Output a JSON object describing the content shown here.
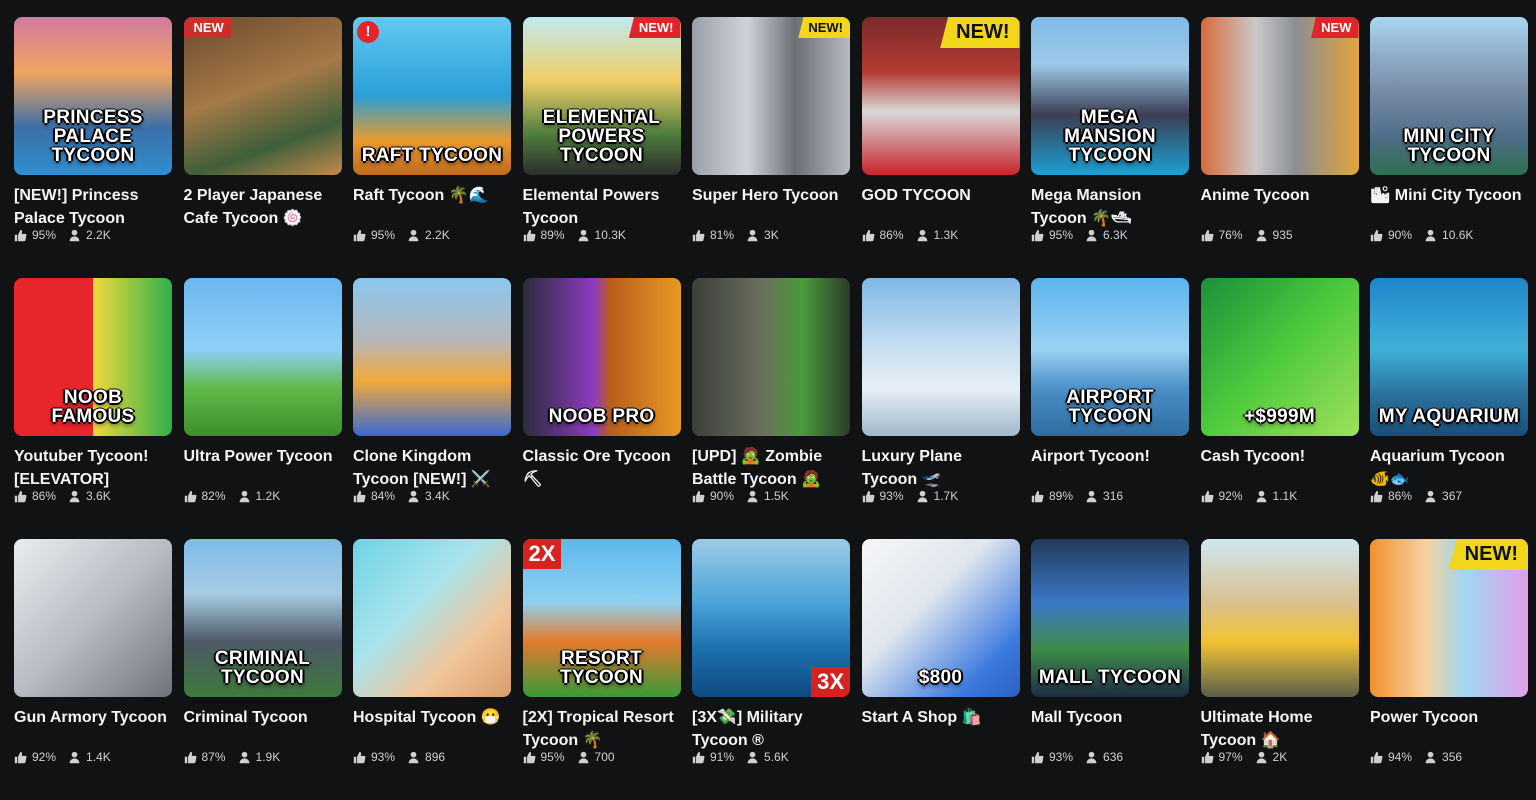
{
  "games": [
    {
      "title": "[NEW!] Princess Palace Tycoon",
      "rating": "95%",
      "players": "2.2K",
      "art_text": "PRINCESS PALACE TYCOON",
      "badge": "",
      "bg": "linear-gradient(180deg,#d07aa0 0%,#f0a460 35%,#3c6fa8 70%,#2d8fd2 100%)"
    },
    {
      "title": "2 Player Japanese Cafe Tycoon 🍥",
      "rating": "",
      "players": "",
      "art_text": "",
      "badge": "NEW",
      "bg": "linear-gradient(160deg,#6b4a2c 0%,#a67a48 45%,#3f5f3a 75%,#c48a4c 100%)"
    },
    {
      "title": "Raft Tycoon 🌴🌊",
      "rating": "95%",
      "players": "2.2K",
      "art_text": "RAFT TYCOON",
      "badge": "!",
      "bg": "linear-gradient(180deg,#63c9f2 0%,#2a9fd8 50%,#e69a2d 78%,#c06b1c 100%)"
    },
    {
      "title": "Elemental Powers Tycoon",
      "rating": "89%",
      "players": "10.3K",
      "art_text": "ELEMENTAL POWERS TYCOON",
      "badge": "NEW!",
      "bg": "linear-gradient(180deg,#bfe9f0 0%,#f0cf66 40%,#4c7b3c 75%,#2d2d2d 100%)"
    },
    {
      "title": "Super Hero Tycoon",
      "rating": "81%",
      "players": "3K",
      "art_text": "",
      "badge": "NEW!",
      "bg": "linear-gradient(90deg,#9aa0a8 0%,#cfd3d8 35%,#6b6f76 65%,#b7bbc0 100%)"
    },
    {
      "title": "GOD TYCOON",
      "rating": "86%",
      "players": "1.3K",
      "art_text": "",
      "badge": "NEW!",
      "bg": "linear-gradient(180deg,#7a2a2a 0%,#b53b33 35%,#d8d8d8 60%,#c8242a 100%)"
    },
    {
      "title": "Mega Mansion Tycoon 🌴🛥",
      "rating": "95%",
      "players": "6.3K",
      "art_text": "MEGA MANSION TYCOON",
      "badge": "",
      "bg": "linear-gradient(180deg,#7fbbe8 0%,#9dc8e8 30%,#3c3f54 62%,#1aa1d6 100%)"
    },
    {
      "title": "Anime Tycoon",
      "rating": "76%",
      "players": "935",
      "art_text": "",
      "badge": "NEW",
      "bg": "linear-gradient(90deg,#d76a3a 0%,#c9c9c9 35%,#8a8d92 60%,#e2a43a 100%)"
    },
    {
      "title": "🏙 Mini City Tycoon",
      "rating": "90%",
      "players": "10.6K",
      "art_text": "MINI CITY TYCOON",
      "badge": "",
      "bg": "linear-gradient(180deg,#a9d4f0 0%,#7b8ea8 45%,#4f6e8a 75%,#2f6f4f 100%)"
    },
    {
      "title": "Youtuber Tycoon! [ELEVATOR]",
      "rating": "86%",
      "players": "3.6K",
      "art_text": "NOOB  FAMOUS",
      "badge": "",
      "bg": "linear-gradient(90deg,#e7262b 0%,#e7262b 50%,#f0d93c 50%,#2fb04a 100%)"
    },
    {
      "title": "Ultra Power Tycoon",
      "rating": "82%",
      "players": "1.2K",
      "art_text": "",
      "badge": "",
      "bg": "linear-gradient(180deg,#6ab6f0 0%,#8fd0f7 45%,#5fb846 70%,#3c8f2c 100%)"
    },
    {
      "title": "Clone Kingdom Tycoon [NEW!] ⚔️",
      "rating": "84%",
      "players": "3.4K",
      "art_text": "",
      "badge": "",
      "bg": "linear-gradient(180deg,#8ac7ef 0%,#b6b6b6 40%,#f1a93a 65%,#3b6ad1 100%)"
    },
    {
      "title": "Classic Ore Tycoon ⛏",
      "rating": "",
      "players": "",
      "art_text": "NOOB    PRO",
      "badge": "",
      "bg": "linear-gradient(90deg,#2b2b3c 0%,#8e3cc1 45%,#b85d1c 55%,#e79a24 100%)"
    },
    {
      "title": "[UPD] 🧟 Zombie Battle Tycoon 🧟",
      "rating": "90%",
      "players": "1.5K",
      "art_text": "",
      "badge": "",
      "bg": "linear-gradient(90deg,#3b3f3a 0%,#6b705f 45%,#4a9b3a 70%,#2c3a2a 100%)"
    },
    {
      "title": "Luxury Plane Tycoon 🛫",
      "rating": "93%",
      "players": "1.7K",
      "art_text": "",
      "badge": "",
      "bg": "linear-gradient(180deg,#7fb7e6 0%,#c9dff0 45%,#e6eef5 70%,#9fb8cc 100%)"
    },
    {
      "title": "Airport Tycoon!",
      "rating": "89%",
      "players": "316",
      "art_text": "AIRPORT TYCOON",
      "badge": "",
      "bg": "linear-gradient(180deg,#5bb4ee 0%,#9bd2f3 45%,#4a8fc8 70%,#2f6da0 100%)"
    },
    {
      "title": "Cash Tycoon!",
      "rating": "92%",
      "players": "1.1K",
      "art_text": "+$999M",
      "badge": "",
      "bg": "linear-gradient(135deg,#1e8f3a 0%,#4fca3e 50%,#9fe05a 100%)"
    },
    {
      "title": "Aquarium Tycoon 🐠🐟",
      "rating": "86%",
      "players": "367",
      "art_text": "MY AQUARIUM",
      "badge": "",
      "bg": "linear-gradient(180deg,#1f86c9 0%,#3fb0d8 45%,#2a6f9a 75%,#1a4f7a 100%)"
    },
    {
      "title": "Gun Armory Tycoon",
      "rating": "92%",
      "players": "1.4K",
      "art_text": "",
      "badge": "",
      "bg": "linear-gradient(135deg,#e9ecef 0%,#b8bcc2 50%,#6f747a 100%)"
    },
    {
      "title": "Criminal Tycoon",
      "rating": "87%",
      "players": "1.9K",
      "art_text": "CRIMINAL TYCOON",
      "badge": "",
      "bg": "linear-gradient(180deg,#7fbbe8 0%,#a7cbe2 35%,#4e5966 65%,#3e7a3c 100%)"
    },
    {
      "title": "Hospital Tycoon 😷",
      "rating": "93%",
      "players": "896",
      "art_text": "",
      "badge": "",
      "bg": "linear-gradient(135deg,#6ed3e3 0%,#a8e3ec 40%,#f0c59a 70%,#d99c6a 100%)"
    },
    {
      "title": "[2X] Tropical Resort Tycoon 🌴",
      "rating": "95%",
      "players": "700",
      "art_text": "RESORT TYCOON",
      "badge": "2X",
      "bg": "linear-gradient(180deg,#5cb8ec 0%,#8fd0f0 40%,#e37a2d 65%,#3a9a3a 100%)"
    },
    {
      "title": "[3X💸] Military Tycoon ®",
      "rating": "91%",
      "players": "5.6K",
      "art_text": "",
      "badge": "3X",
      "bg": "linear-gradient(180deg,#9ccbe8 0%,#4aa4d8 40%,#1e6fae 70%,#0f4a80 100%)"
    },
    {
      "title": "Start A Shop 🛍️",
      "rating": "",
      "players": "",
      "art_text": "$800",
      "badge": "",
      "bg": "linear-gradient(135deg,#f6f6f6 0%,#dfe6ee 40%,#3d7be0 80%,#2b5fbf 100%)"
    },
    {
      "title": "Mall Tycoon",
      "rating": "93%",
      "players": "636",
      "art_text": "MALL TYCOON",
      "badge": "",
      "bg": "linear-gradient(180deg,#233a5a 0%,#3a79c9 40%,#3f8c48 70%,#1d2c45 100%)"
    },
    {
      "title": "Ultimate Home Tycoon 🏠",
      "rating": "97%",
      "players": "2K",
      "art_text": "",
      "badge": "",
      "bg": "linear-gradient(180deg,#cfe6f2 0%,#d9c08f 40%,#f2c232 65%,#5a5f4a 100%)"
    },
    {
      "title": "Power Tycoon",
      "rating": "94%",
      "players": "356",
      "art_text": "",
      "badge": "NEW!",
      "bg": "linear-gradient(90deg,#f0902c 0%,#f7d1a0 35%,#9fd7f0 60%,#e0a0e8 100%)"
    }
  ],
  "icons": {
    "rating": "thumbs-up-icon",
    "players": "person-icon"
  }
}
